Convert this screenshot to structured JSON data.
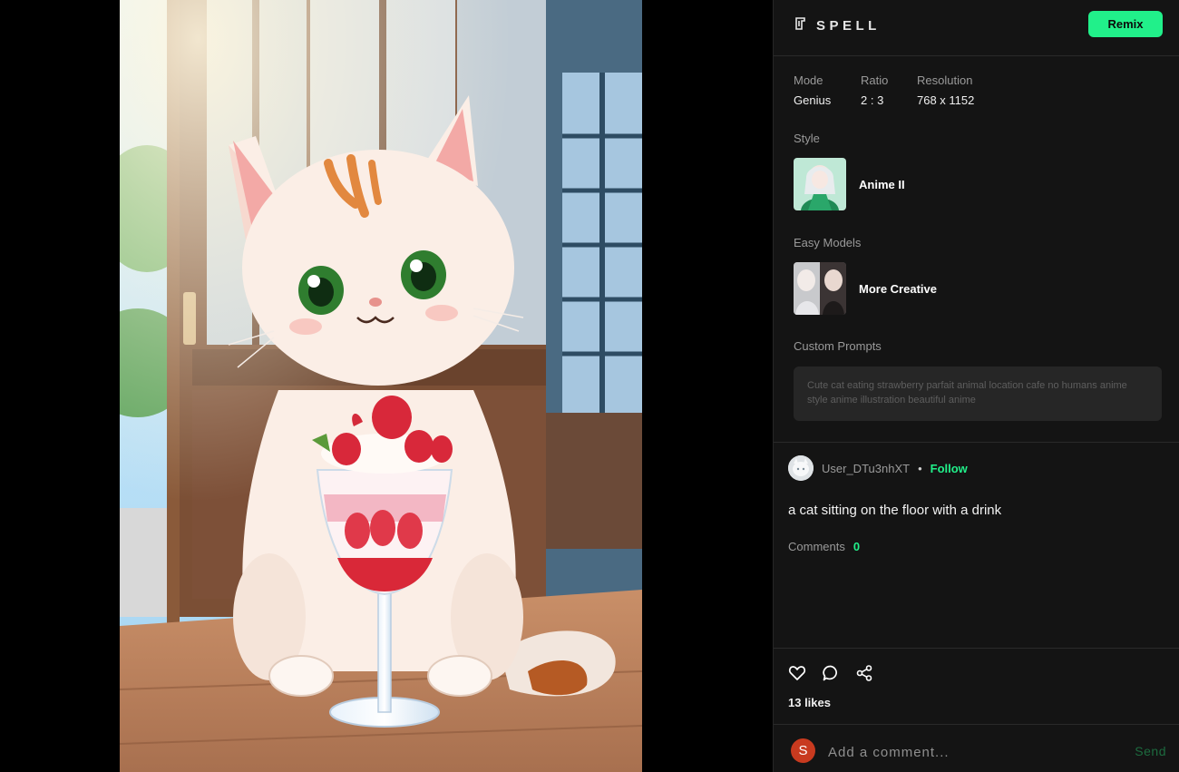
{
  "image": {
    "description_icon": "generated-artwork"
  },
  "header": {
    "brand": "SPELL",
    "brand_icon": "spell-logo-icon",
    "remix_label": "Remix",
    "accent": "#21f08a"
  },
  "meta": {
    "mode_label": "Mode",
    "mode_value": "Genius",
    "ratio_label": "Ratio",
    "ratio_value": "2 : 3",
    "resolution_label": "Resolution",
    "resolution_value": "768 x 1152"
  },
  "style": {
    "label": "Style",
    "name": "Anime II"
  },
  "easy_models": {
    "label": "Easy Models",
    "name": "More Creative"
  },
  "custom_prompts": {
    "label": "Custom Prompts",
    "text": "Cute cat eating strawberry parfait animal location cafe no humans anime style anime illustration beautiful anime"
  },
  "post": {
    "username": "User_DTu3nhXT",
    "separator": "•",
    "follow_label": "Follow",
    "caption": "a cat sitting on the floor with a drink",
    "comments_label": "Comments",
    "comments_count": "0",
    "likes": "13 likes"
  },
  "comment_bar": {
    "avatar_letter": "S",
    "avatar_color": "#c83a1f",
    "placeholder": "Add a comment...",
    "send_label": "Send"
  }
}
